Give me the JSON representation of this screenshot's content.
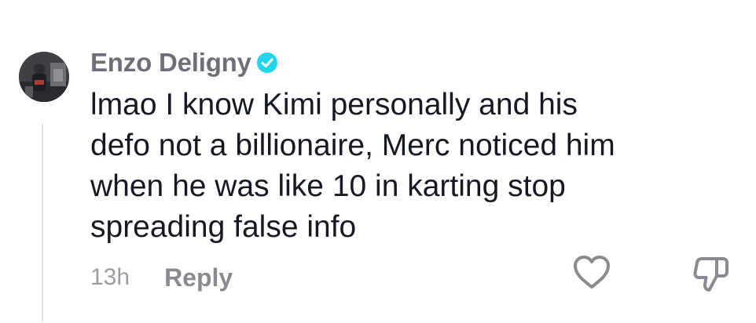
{
  "comment": {
    "author": "Enzo Deligny",
    "verified": true,
    "text": "lmao I know Kimi personally and his\ndefo not a billionaire, Merc noticed him\nwhen he was like 10 in karting stop\nspreading false info",
    "timestamp": "13h",
    "reply_label": "Reply"
  },
  "icons": {
    "verified": "verified-badge-icon",
    "like": "heart-icon",
    "dislike": "thumbs-down-icon"
  },
  "colors": {
    "verified_badge": "#20D5EC",
    "username": "#6F7077",
    "text": "#161823",
    "muted": "#9B9CA1"
  }
}
